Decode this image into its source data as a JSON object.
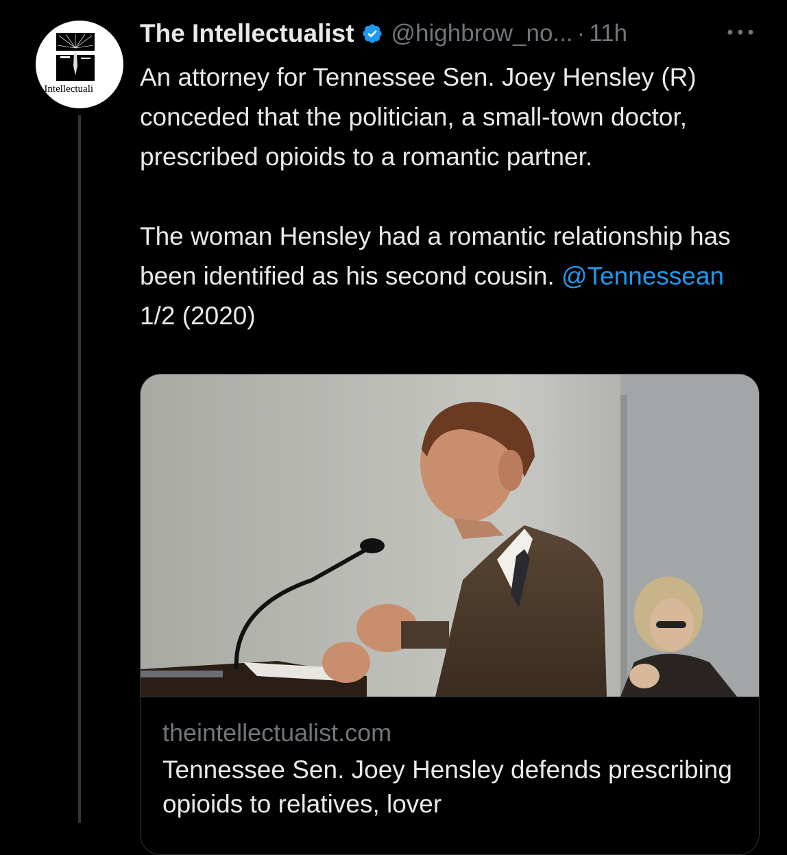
{
  "account": {
    "avatar_text": "e Intellectuali",
    "display_name": "The Intellectualist",
    "handle": "@highbrow_no...",
    "separator": "·",
    "time": "11h",
    "verified_color": "#1d9bf0"
  },
  "tweet": {
    "paragraph1": "An attorney for Tennessee Sen. Joey Hensley (R) conceded that the politician, a small-town doctor, prescribed opioids to a romantic partner.",
    "paragraph2_text": "The woman Hensley had a romantic relationship has been identified as his second cousin.",
    "mention": "@Tennessean",
    "thread_marker": "1/2 (2020)"
  },
  "card": {
    "image_icon": "photo-of-senator-at-podium",
    "domain": "theintellectualist.com",
    "title": "Tennessee Sen. Joey Hensley defends prescribing opioids to relatives, lover"
  },
  "colors": {
    "background": "#000000",
    "text": "#e7e9ea",
    "muted": "#71767b",
    "link": "#1d9bf0",
    "border": "#2f3336"
  }
}
